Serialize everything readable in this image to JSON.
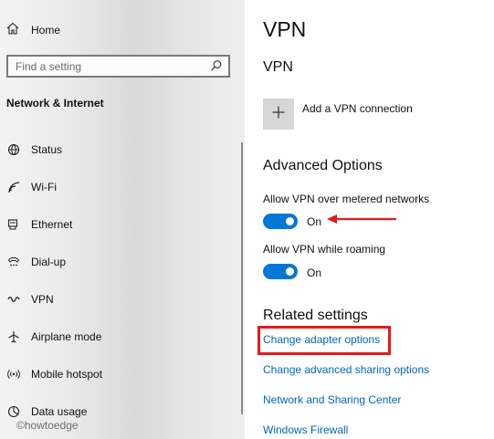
{
  "sidebar": {
    "home_label": "Home",
    "search_placeholder": "Find a setting",
    "section_title": "Network & Internet",
    "items": [
      {
        "label": "Status",
        "icon": "status-icon"
      },
      {
        "label": "Wi-Fi",
        "icon": "wifi-icon"
      },
      {
        "label": "Ethernet",
        "icon": "ethernet-icon"
      },
      {
        "label": "Dial-up",
        "icon": "dialup-icon"
      },
      {
        "label": "VPN",
        "icon": "vpn-icon"
      },
      {
        "label": "Airplane mode",
        "icon": "airplane-icon"
      },
      {
        "label": "Mobile hotspot",
        "icon": "hotspot-icon"
      },
      {
        "label": "Data usage",
        "icon": "data-usage-icon"
      }
    ],
    "watermark": "©howtoedge"
  },
  "main": {
    "page_title": "VPN",
    "vpn_section": "VPN",
    "add_vpn_label": "Add a VPN connection",
    "advanced_title": "Advanced Options",
    "options": [
      {
        "label": "Allow VPN over metered networks",
        "state": "On"
      },
      {
        "label": "Allow VPN while roaming",
        "state": "On"
      }
    ],
    "related_title": "Related settings",
    "related_links": [
      "Change adapter options",
      "Change advanced sharing options",
      "Network and Sharing Center",
      "Windows Firewall"
    ]
  },
  "colors": {
    "accent": "#0078d7",
    "link": "#0067b8",
    "annotation": "#e31b1b"
  }
}
